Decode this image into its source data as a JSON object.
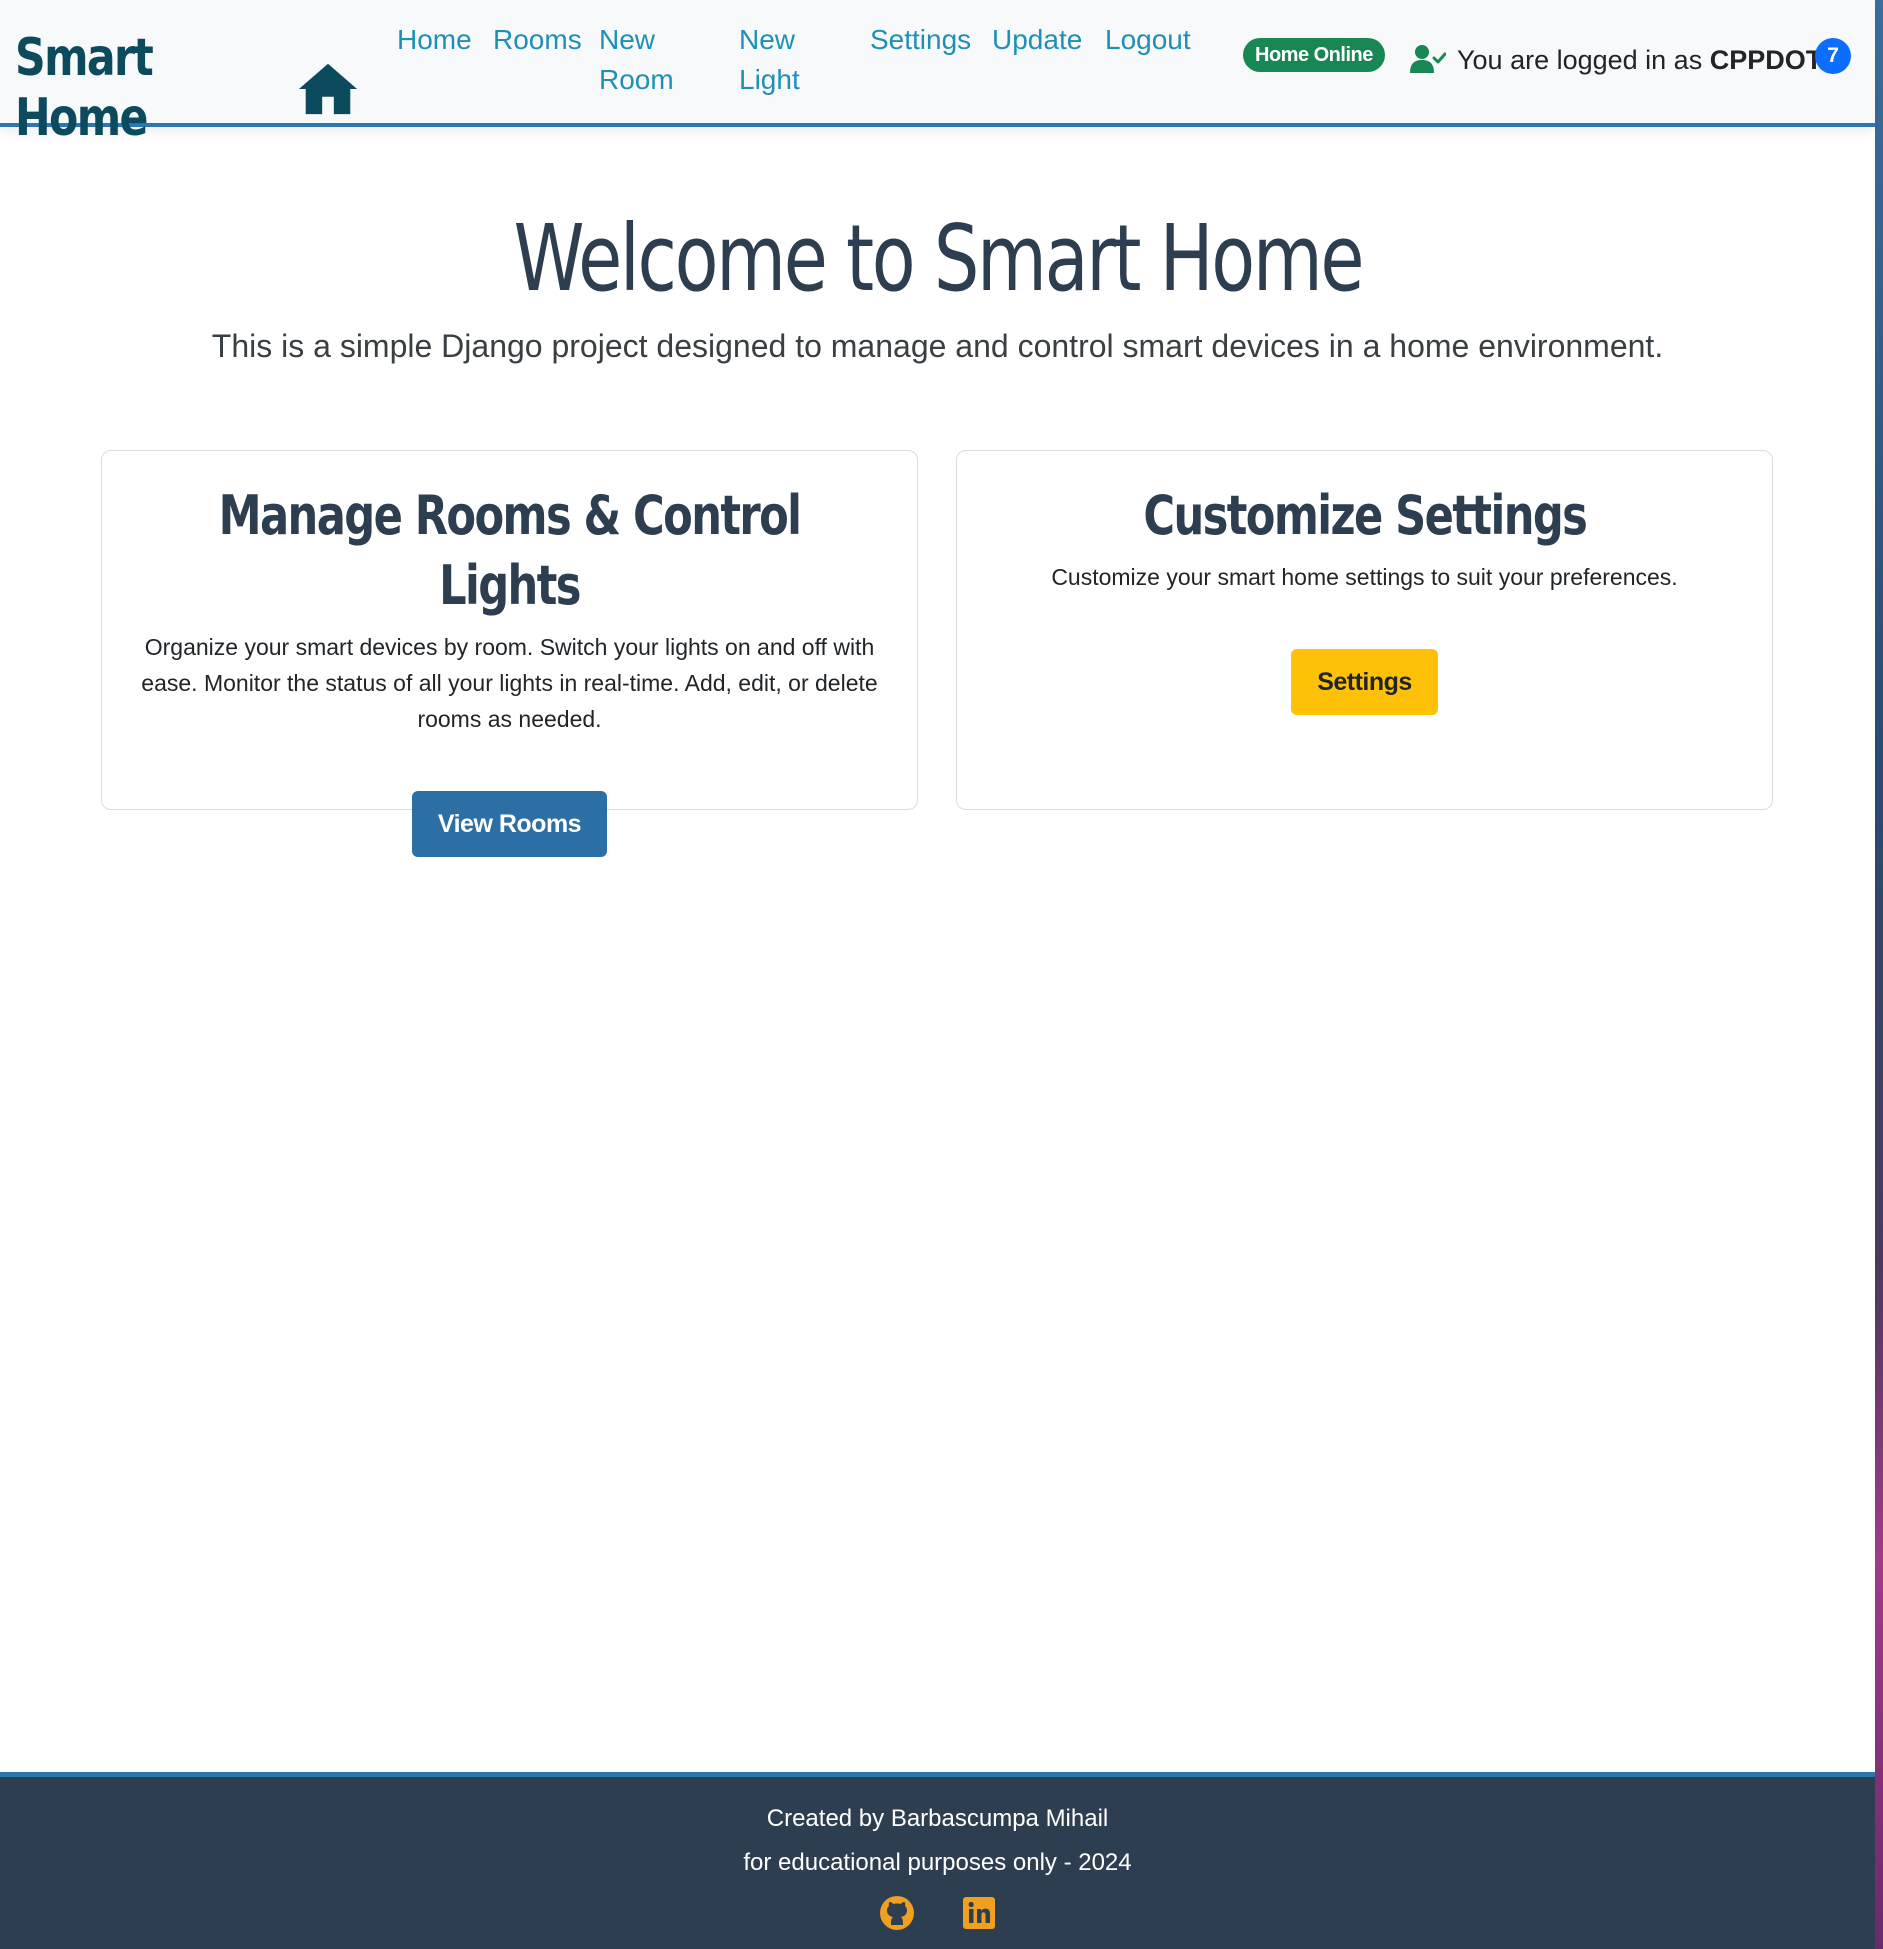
{
  "navbar": {
    "brand": "Smart Home",
    "brand_icon": "house-icon",
    "links": {
      "home": "Home",
      "rooms": "Rooms",
      "new_room_l1": "New",
      "new_room_l2": "Room",
      "new_light_l1": "New",
      "new_light_l2": "Light",
      "settings": "Settings",
      "update": "Update",
      "logout": "Logout"
    },
    "status": "Home Online",
    "user_prefix": "You are logged in as",
    "username": "CPPDOTH",
    "badge_count": "7"
  },
  "hero": {
    "title": "Welcome to Smart Home",
    "subtitle": "This is a simple Django project designed to manage and control smart devices in a home environment."
  },
  "cards": {
    "rooms": {
      "title": "Manage Rooms & Control Lights",
      "text": "Organize your smart devices by room. Switch your lights on and off with ease. Monitor the status of all your lights in real-time. Add, edit, or delete rooms as needed.",
      "button": "View Rooms"
    },
    "settings": {
      "title": "Customize Settings",
      "text": "Customize your smart home settings to suit your preferences.",
      "button": "Settings"
    }
  },
  "footer": {
    "line1": "Created by Barbascumpa Mihail",
    "line2": "for educational purposes only - 2024",
    "icons": [
      "github-icon",
      "linkedin-icon"
    ]
  },
  "colors": {
    "brand": "#0c4a5e",
    "link": "#1e90b8",
    "accent": "#2c77b0",
    "status": "#198754",
    "warning": "#ffc107",
    "footer_bg": "#2c3e50",
    "footer_icon": "#f0a020"
  }
}
